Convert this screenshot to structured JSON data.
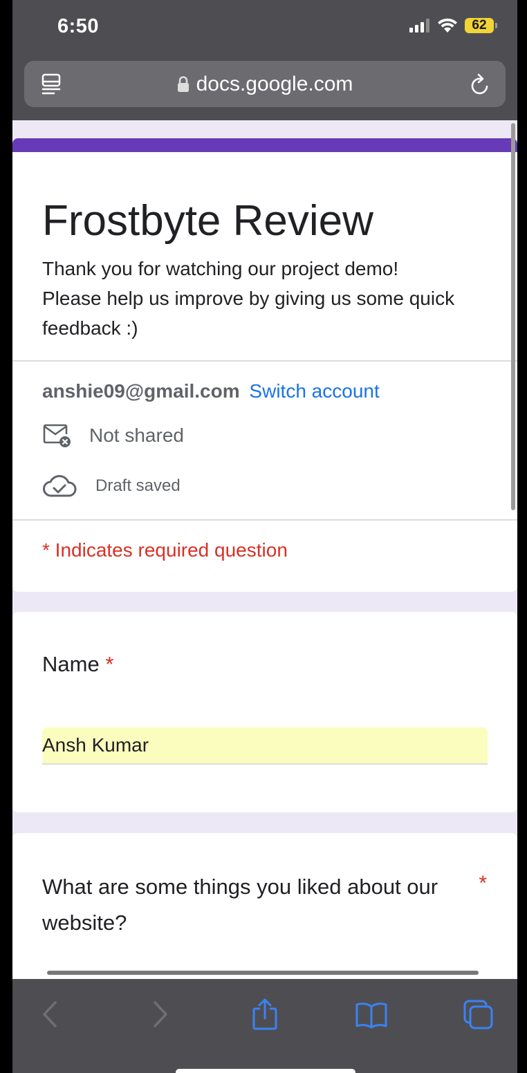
{
  "status_bar": {
    "time": "6:50",
    "battery": "62",
    "icons": [
      "signal-icon",
      "wifi-icon",
      "battery-icon"
    ]
  },
  "browser": {
    "url": "docs.google.com",
    "icons": [
      "reader-icon",
      "lock-icon",
      "reload-icon"
    ]
  },
  "form": {
    "title": "Frostbyte Review",
    "description": "Thank you for watching our project demo!\nPlease help us improve by giving us some quick feedback :)",
    "account_email": "anshie09@gmail.com",
    "switch_account": "Switch account",
    "not_shared": "Not shared",
    "draft_saved": "Draft saved",
    "required_note": "* Indicates required question",
    "accent_color": "#673ab7",
    "required_color": "#d93025"
  },
  "questions": [
    {
      "label": "Name",
      "required_mark": "*",
      "value": "Ansh Kumar"
    },
    {
      "label": "What are some things you liked about our website?",
      "required_mark": "*"
    }
  ],
  "toolbar": {
    "buttons": [
      "back-icon",
      "forward-icon",
      "share-icon",
      "bookmarks-icon",
      "tabs-icon"
    ]
  }
}
